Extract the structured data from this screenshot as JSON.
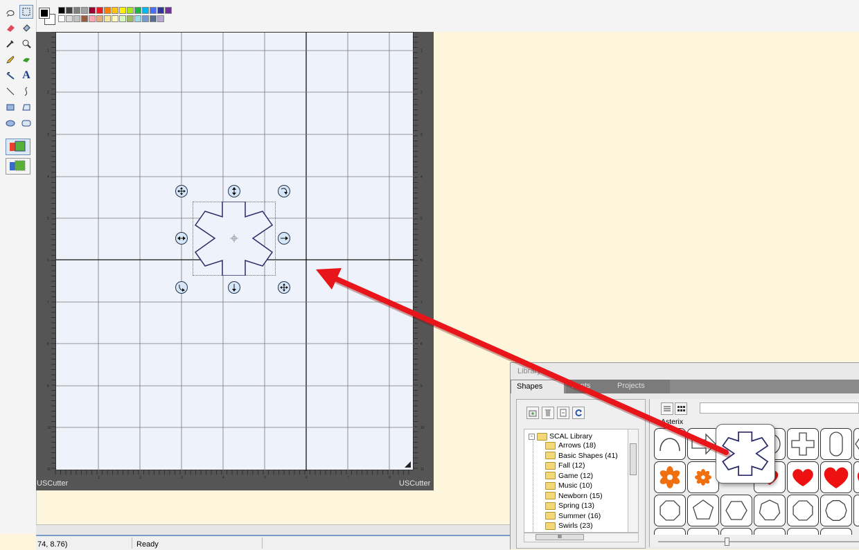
{
  "palette": {
    "row1": [
      "#000000",
      "#404040",
      "#7f7f7f",
      "#a0a0a0",
      "#990030",
      "#ed1c24",
      "#ff7e00",
      "#ffc20e",
      "#fff200",
      "#a8e61d",
      "#22b14c",
      "#00b7ef",
      "#4d6df3",
      "#2f3699",
      "#6f3198"
    ],
    "row2": [
      "#ffffff",
      "#dcdcdc",
      "#c3c3c3",
      "#9c5a3c",
      "#ffa3b1",
      "#e5aa7a",
      "#f5e49c",
      "#fff9bd",
      "#d3f9bc",
      "#9dbb61",
      "#99d9ea",
      "#709ad1",
      "#546d8e",
      "#b5a5d5"
    ],
    "current_fg": "#000000",
    "current_bg": "#ffffff"
  },
  "tools": [
    "lasso-tool-icon",
    "rectangle-select-icon",
    "eraser-icon",
    "fill-icon",
    "eyedropper-icon",
    "zoom-icon",
    "pencil-icon",
    "brush-icon",
    "pen-icon",
    "text-icon",
    "line-icon",
    "curve-icon",
    "rectangle-icon",
    "polygon-icon",
    "ellipse-icon",
    "rounded-rect-icon",
    "layer-mode-1-icon",
    "layer-mode-2-icon"
  ],
  "text_tool_glyph": "A",
  "mat": {
    "brand_left": "USCutter",
    "brand_right": "USCutter",
    "ruler_left": [
      "1",
      "2",
      "3",
      "4",
      "5",
      "6",
      "7",
      "8",
      "9",
      "10",
      "11"
    ],
    "ruler_bottom": [
      "1",
      "2",
      "3",
      "4",
      "5",
      "6",
      "7",
      "8"
    ]
  },
  "library": {
    "title": "Library",
    "tabs": [
      "Shapes",
      "Fonts",
      "Projects"
    ],
    "search_value": "",
    "selected_shape_label": "Asterix",
    "tree_root": "SCAL Library",
    "tree_items": [
      "Arrows (18)",
      "Basic Shapes (41)",
      "Fall (12)",
      "Game (12)",
      "Music (10)",
      "Newborn (15)",
      "Spring (13)",
      "Summer (16)",
      "Swirls (23)"
    ],
    "hscroll_grip": "III",
    "colors": {
      "heart": "#ee1111",
      "flower": "#f07010"
    }
  },
  "status": {
    "coords": "74, 8.76)",
    "state": "Ready"
  },
  "annotation": {
    "arrow_color": "#e8161a"
  }
}
